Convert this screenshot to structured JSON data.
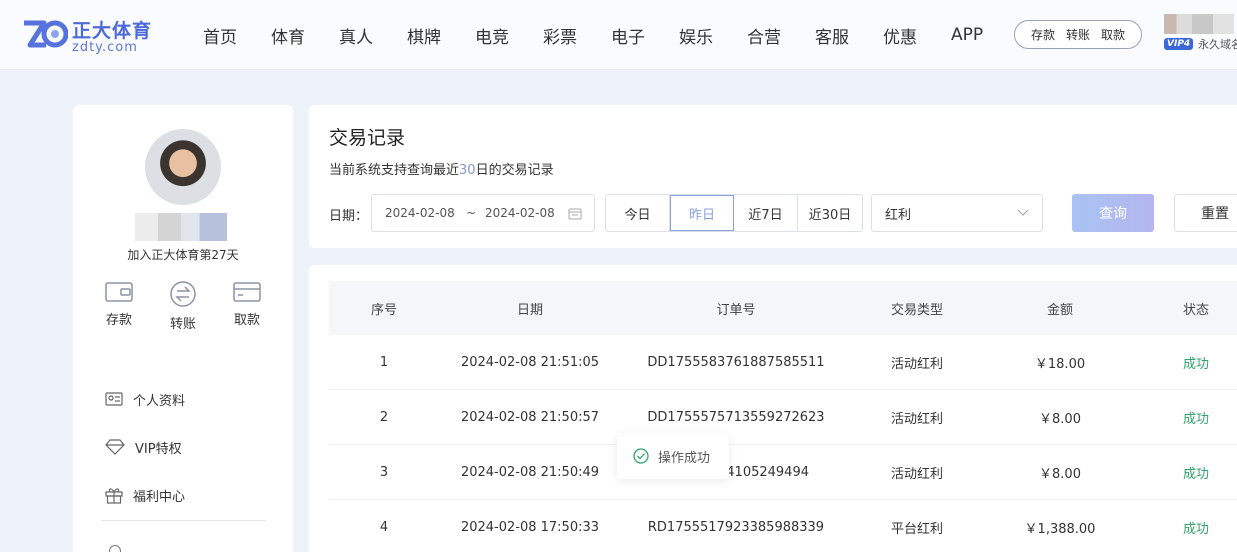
{
  "brand": {
    "name_cn": "正大体育",
    "domain": "zdty.com"
  },
  "nav": [
    "首页",
    "体育",
    "真人",
    "棋牌",
    "电竞",
    "彩票",
    "电子",
    "娱乐",
    "合营",
    "客服",
    "优惠",
    "APP"
  ],
  "quick_actions": [
    "存款",
    "转账",
    "取款"
  ],
  "user": {
    "vip_badge": "VIP4",
    "domain_label": "永久域名",
    "join_text": "加入正大体育第27天"
  },
  "sidebar": {
    "actions": [
      {
        "label": "存款",
        "icon": "wallet-icon"
      },
      {
        "label": "转账",
        "icon": "transfer-icon"
      },
      {
        "label": "取款",
        "icon": "card-icon"
      }
    ],
    "menu": [
      {
        "label": "个人资料",
        "icon": "id-card-icon"
      },
      {
        "label": "VIP特权",
        "icon": "diamond-icon"
      },
      {
        "label": "福利中心",
        "icon": "gift-icon"
      }
    ]
  },
  "filter": {
    "title": "交易记录",
    "subtitle_prefix": "当前系统支持查询最近",
    "subtitle_days": "30",
    "subtitle_suffix": "日的交易记录",
    "date_label": "日期：",
    "start_date": "2024-02-08",
    "separator": "~",
    "end_date": "2024-02-08",
    "quick_dates": [
      "今日",
      "昨日",
      "近7日",
      "近30日"
    ],
    "active_quick_date": "昨日",
    "type_selected": "红利",
    "query_label": "查询",
    "reset_label": "重置"
  },
  "table": {
    "headers": [
      "序号",
      "日期",
      "订单号",
      "交易类型",
      "金额",
      "状态"
    ],
    "rows": [
      [
        "1",
        "2024-02-08 21:51:05",
        "DD1755583761887585511",
        "活动红利",
        "￥18.00",
        "成功"
      ],
      [
        "2",
        "2024-02-08 21:50:57",
        "DD1755575713559272623",
        "活动红利",
        "￥8.00",
        "成功"
      ],
      [
        "3",
        "2024-02-08 21:50:49",
        "104105249494",
        "活动红利",
        "￥8.00",
        "成功"
      ],
      [
        "4",
        "2024-02-08 17:50:33",
        "RD1755517923385988339",
        "平台红利",
        "￥1,388.00",
        "成功"
      ]
    ]
  },
  "toast": {
    "text": "操作成功"
  },
  "colors": {
    "brand": "#4d6ad8",
    "success": "#2fa46b",
    "accent": "#8aa0e0"
  }
}
